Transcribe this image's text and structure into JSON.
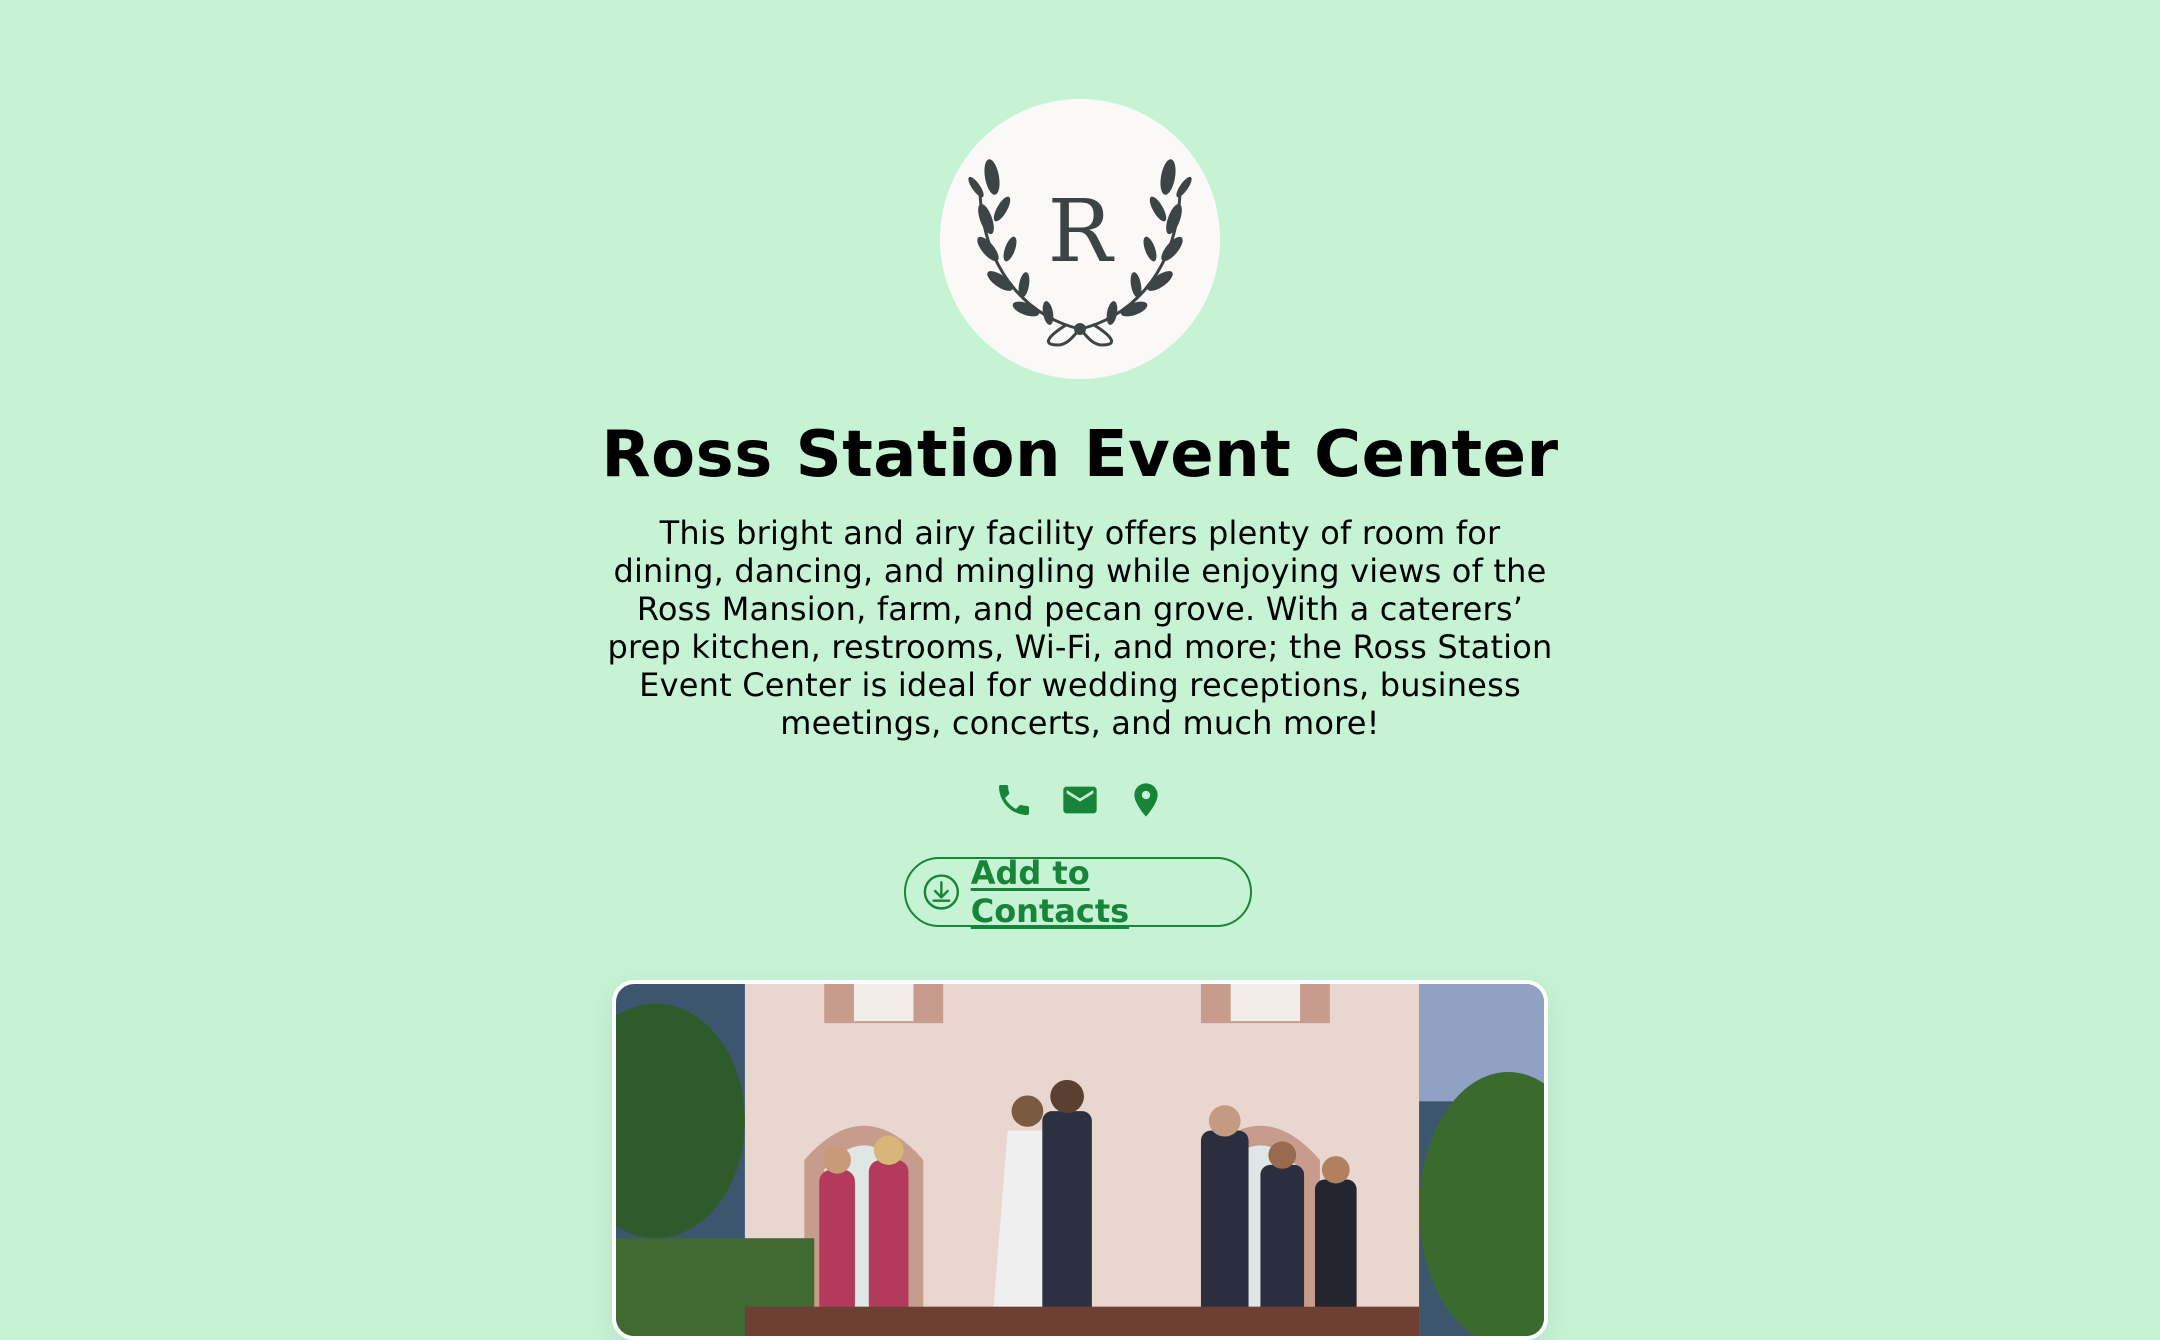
{
  "profile": {
    "monogram": "R",
    "name": "Ross Station Event Center",
    "description": "This bright and airy facility offers plenty of room for dining, dancing, and mingling while enjoying views of the Ross Mansion, farm, and pecan grove. With a caterers’ prep kitchen, restrooms, Wi-Fi, and more; the Ross Station Event Center is ideal for wedding receptions, business meetings, concerts, and much more!"
  },
  "contacts": {
    "icons": [
      "phone-icon",
      "mail-icon",
      "location-pin-icon"
    ]
  },
  "actions": {
    "add_to_contacts_label": "Add to Contacts",
    "add_to_contacts_icon": "download-icon"
  },
  "colors": {
    "background": "#c7f3d5",
    "accent": "#18843a",
    "text": "#000000"
  }
}
